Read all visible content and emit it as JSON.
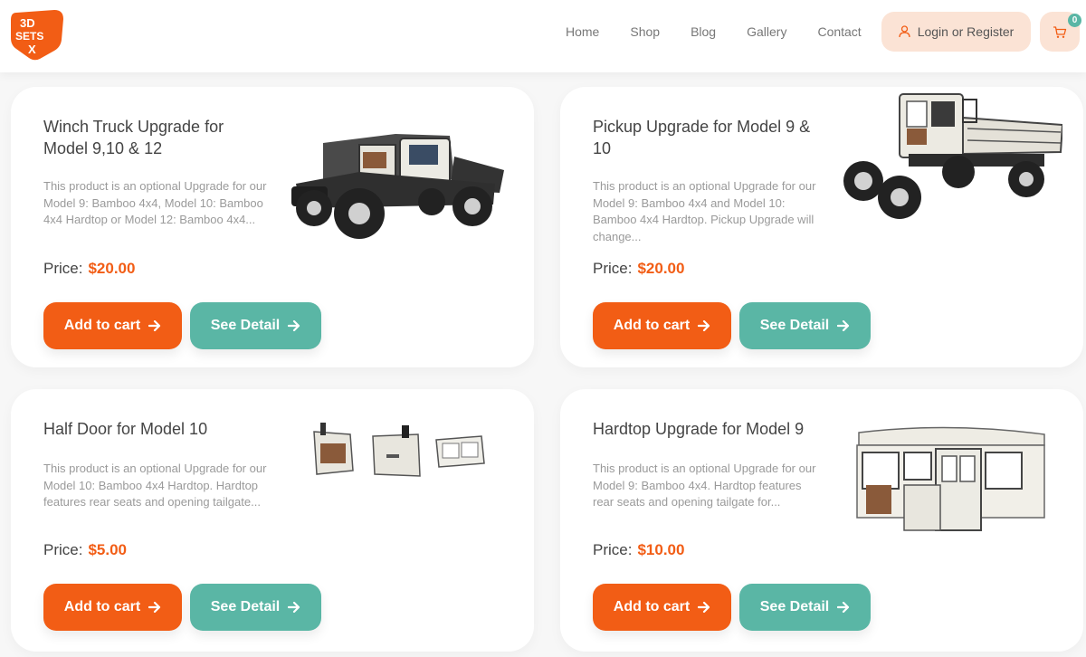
{
  "header": {
    "logo_text": [
      "3D",
      "SETS",
      "X"
    ],
    "nav": [
      "Home",
      "Shop",
      "Blog",
      "Gallery",
      "Contact"
    ],
    "login_label": "Login or Register",
    "cart_count": "0"
  },
  "products": [
    {
      "title": "Winch Truck Upgrade for Model 9,10 & 12",
      "description": "This product is an optional Upgrade for our Model 9: Bamboo 4x4, Model 10: Bamboo 4x4 Hardtop or Model 12: Bamboo 4x4...",
      "price_label": "Price:",
      "price": "$20.00",
      "add_to_cart": "Add to cart",
      "see_detail": "See Detail"
    },
    {
      "title": "Pickup Upgrade for Model 9 & 10",
      "description": "This product is an optional Upgrade for our Model 9: Bamboo 4x4 and Model 10: Bamboo 4x4 Hardtop. Pickup Upgrade will change...",
      "price_label": "Price:",
      "price": "$20.00",
      "add_to_cart": "Add to cart",
      "see_detail": "See Detail"
    },
    {
      "title": "Half Door for Model 10",
      "description": "This product is an optional Upgrade for our Model 10: Bamboo 4x4 Hardtop. Hardtop features rear seats and opening tailgate...",
      "price_label": "Price:",
      "price": "$5.00",
      "add_to_cart": "Add to cart",
      "see_detail": "See Detail"
    },
    {
      "title": "Hardtop Upgrade for Model 9",
      "description": "This product is an optional Upgrade for our Model 9: Bamboo 4x4. Hardtop features rear seats and opening tailgate for...",
      "price_label": "Price:",
      "price": "$10.00",
      "add_to_cart": "Add to cart",
      "see_detail": "See Detail"
    }
  ],
  "colors": {
    "accent_orange": "#f25d15",
    "accent_teal": "#5ab6a5",
    "login_bg": "#fbe3d5"
  },
  "icons": {
    "user": "user-icon",
    "cart": "cart-icon",
    "arrow": "arrow-right-icon"
  }
}
